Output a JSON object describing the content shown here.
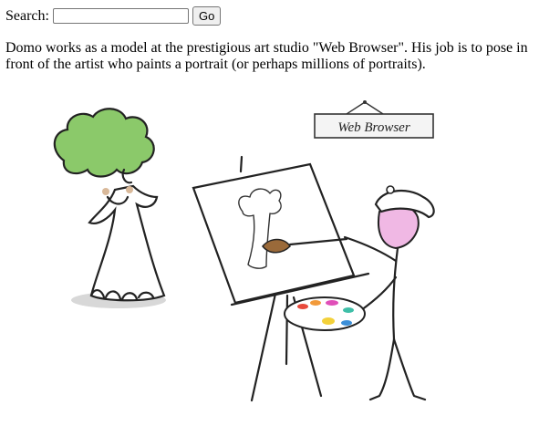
{
  "search": {
    "label": "Search:",
    "placeholder": "",
    "value": "",
    "button_label": "Go"
  },
  "description": "Domo works as a model at the prestigious art studio \"Web Browser\". His job is to pose in front of the artist who paints a portrait (or perhaps millions of portraits).",
  "illustration": {
    "sign_text": "Web Browser",
    "colors": {
      "broccoli_green": "#8bc96a",
      "blush": "#d9b99a",
      "artist_pink": "#f0b8e4",
      "palette_red": "#e84a3c",
      "palette_orange": "#f29a3a",
      "palette_magenta": "#e04fb8",
      "palette_yellow": "#f3d13a",
      "palette_blue": "#3c8fd8",
      "palette_teal": "#3fbfa8"
    }
  }
}
